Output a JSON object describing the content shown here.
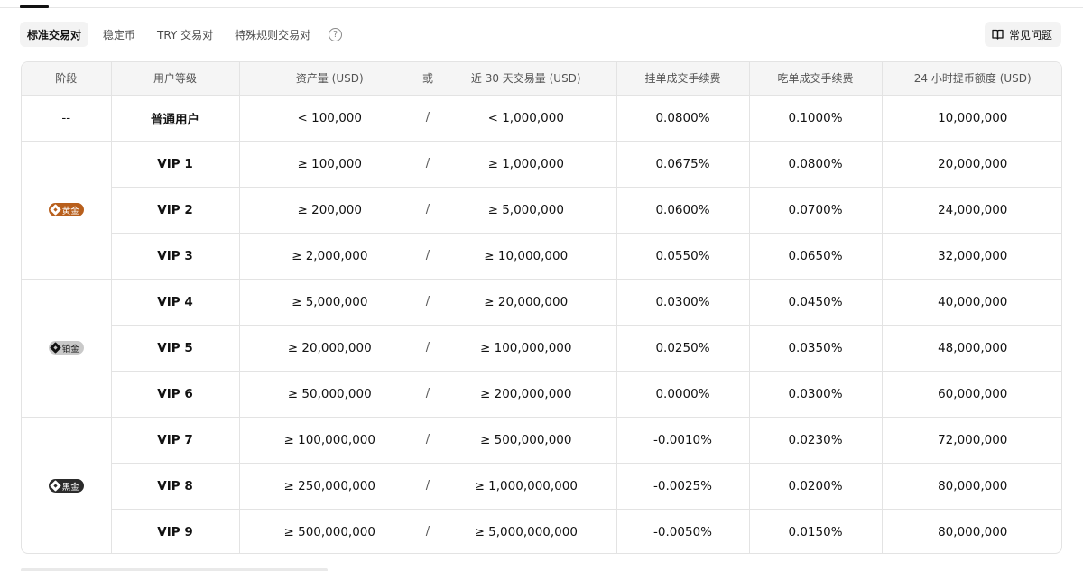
{
  "tabs": [
    {
      "label": "标准交易对"
    },
    {
      "label": "稳定币"
    },
    {
      "label": "TRY 交易对"
    },
    {
      "label": "特殊规则交易对"
    }
  ],
  "faq_button": {
    "label": "常见问题"
  },
  "help_icon": "?",
  "table": {
    "headers": {
      "stage": "阶段",
      "level": "用户等级",
      "assets": "资产量 (USD)",
      "or": "或",
      "volume": "近 30 天交易量 (USD)",
      "maker": "挂单成交手续费",
      "taker": "吃单成交手续费",
      "withdraw": "24 小时提币额度 (USD)"
    },
    "stages": {
      "regular": "--",
      "gold": "黄金",
      "platinum": "铂金",
      "black": "黑金"
    },
    "slash": "/",
    "rows": [
      {
        "level": "普通用户",
        "assets": "< 100,000",
        "volume": "< 1,000,000",
        "maker": "0.0800%",
        "taker": "0.1000%",
        "withdraw": "10,000,000"
      },
      {
        "level": "VIP 1",
        "assets": "≥ 100,000",
        "volume": "≥ 1,000,000",
        "maker": "0.0675%",
        "taker": "0.0800%",
        "withdraw": "20,000,000"
      },
      {
        "level": "VIP 2",
        "assets": "≥ 200,000",
        "volume": "≥ 5,000,000",
        "maker": "0.0600%",
        "taker": "0.0700%",
        "withdraw": "24,000,000"
      },
      {
        "level": "VIP 3",
        "assets": "≥ 2,000,000",
        "volume": "≥ 10,000,000",
        "maker": "0.0550%",
        "taker": "0.0650%",
        "withdraw": "32,000,000"
      },
      {
        "level": "VIP 4",
        "assets": "≥ 5,000,000",
        "volume": "≥ 20,000,000",
        "maker": "0.0300%",
        "taker": "0.0450%",
        "withdraw": "40,000,000"
      },
      {
        "level": "VIP 5",
        "assets": "≥ 20,000,000",
        "volume": "≥ 100,000,000",
        "maker": "0.0250%",
        "taker": "0.0350%",
        "withdraw": "48,000,000"
      },
      {
        "level": "VIP 6",
        "assets": "≥ 50,000,000",
        "volume": "≥ 200,000,000",
        "maker": "0.0000%",
        "taker": "0.0300%",
        "withdraw": "60,000,000"
      },
      {
        "level": "VIP 7",
        "assets": "≥ 100,000,000",
        "volume": "≥ 500,000,000",
        "maker": "-0.0010%",
        "taker": "0.0230%",
        "withdraw": "72,000,000"
      },
      {
        "level": "VIP 8",
        "assets": "≥ 250,000,000",
        "volume": "≥ 1,000,000,000",
        "maker": "-0.0025%",
        "taker": "0.0200%",
        "withdraw": "80,000,000"
      },
      {
        "level": "VIP 9",
        "assets": "≥ 500,000,000",
        "volume": "≥ 5,000,000,000",
        "maker": "-0.0050%",
        "taker": "0.0150%",
        "withdraw": "80,000,000"
      }
    ]
  },
  "colors": {
    "gold_badge": "#b85f1c",
    "platinum_badge": "#c9c9c9",
    "black_badge": "#2b2b2b",
    "header_bg": "#f5f5f5",
    "border": "#e3e3e3"
  },
  "icons": {
    "faq": "book-icon",
    "help": "question-circle-icon",
    "badge": "diamond-icon"
  }
}
